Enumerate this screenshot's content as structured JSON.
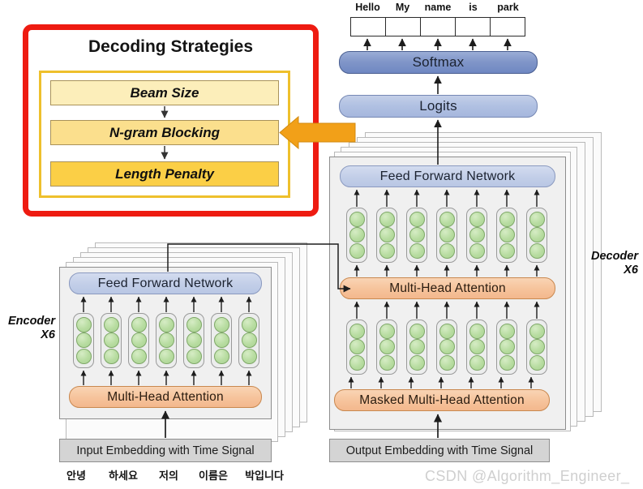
{
  "output_tokens": {
    "labels": [
      "Hello",
      "My",
      "name",
      "is",
      "park"
    ]
  },
  "pipeline": {
    "softmax_label": "Softmax",
    "logits_label": "Logits"
  },
  "encoder": {
    "side_label_line1": "Encoder",
    "side_label_line2": "X6",
    "ffn_label": "Feed Forward Network",
    "attention_label": "Multi-Head Attention",
    "embedding_label": "Input Embedding with Time Signal",
    "columns": 7,
    "neurons_per_column": 3,
    "stack_layers": 5
  },
  "decoder": {
    "side_label_line1": "Decoder",
    "side_label_line2": "X6",
    "ffn_label": "Feed Forward Network",
    "cross_attention_label": "Multi-Head Attention",
    "masked_attention_label": "Masked Multi-Head Attention",
    "embedding_label": "Output Embedding with Time Signal",
    "columns": 7,
    "neurons_per_column": 3,
    "stack_layers": 5
  },
  "input_tokens": {
    "labels": [
      "안녕",
      "하세요",
      "저의",
      "이름은",
      "박입니다"
    ]
  },
  "decoding_strategies": {
    "title": "Decoding Strategies",
    "items": [
      {
        "label": "Beam Size"
      },
      {
        "label": "N-gram Blocking"
      },
      {
        "label": "Length Penalty"
      }
    ]
  },
  "watermark": {
    "text": "CSDN @Algorithm_Engineer_"
  },
  "colors": {
    "callout_border": "#ee1b11",
    "callout_inner_border": "#eec02c",
    "arrow_highlight": "#f0a01a",
    "beam_size_fill": "#fceeba",
    "ngram_fill": "#fbdf8d",
    "length_penalty_fill": "#fbcf46",
    "softmax_fill": "#7d94c6",
    "logits_fill": "#b0c0e2",
    "ffn_fill": "#c2cee8",
    "attention_fill": "#f6c39b",
    "neuron_fill": "#b7dca0",
    "embedding_fill": "#d4d4d4",
    "panel_fill": "#f0f0f0"
  }
}
